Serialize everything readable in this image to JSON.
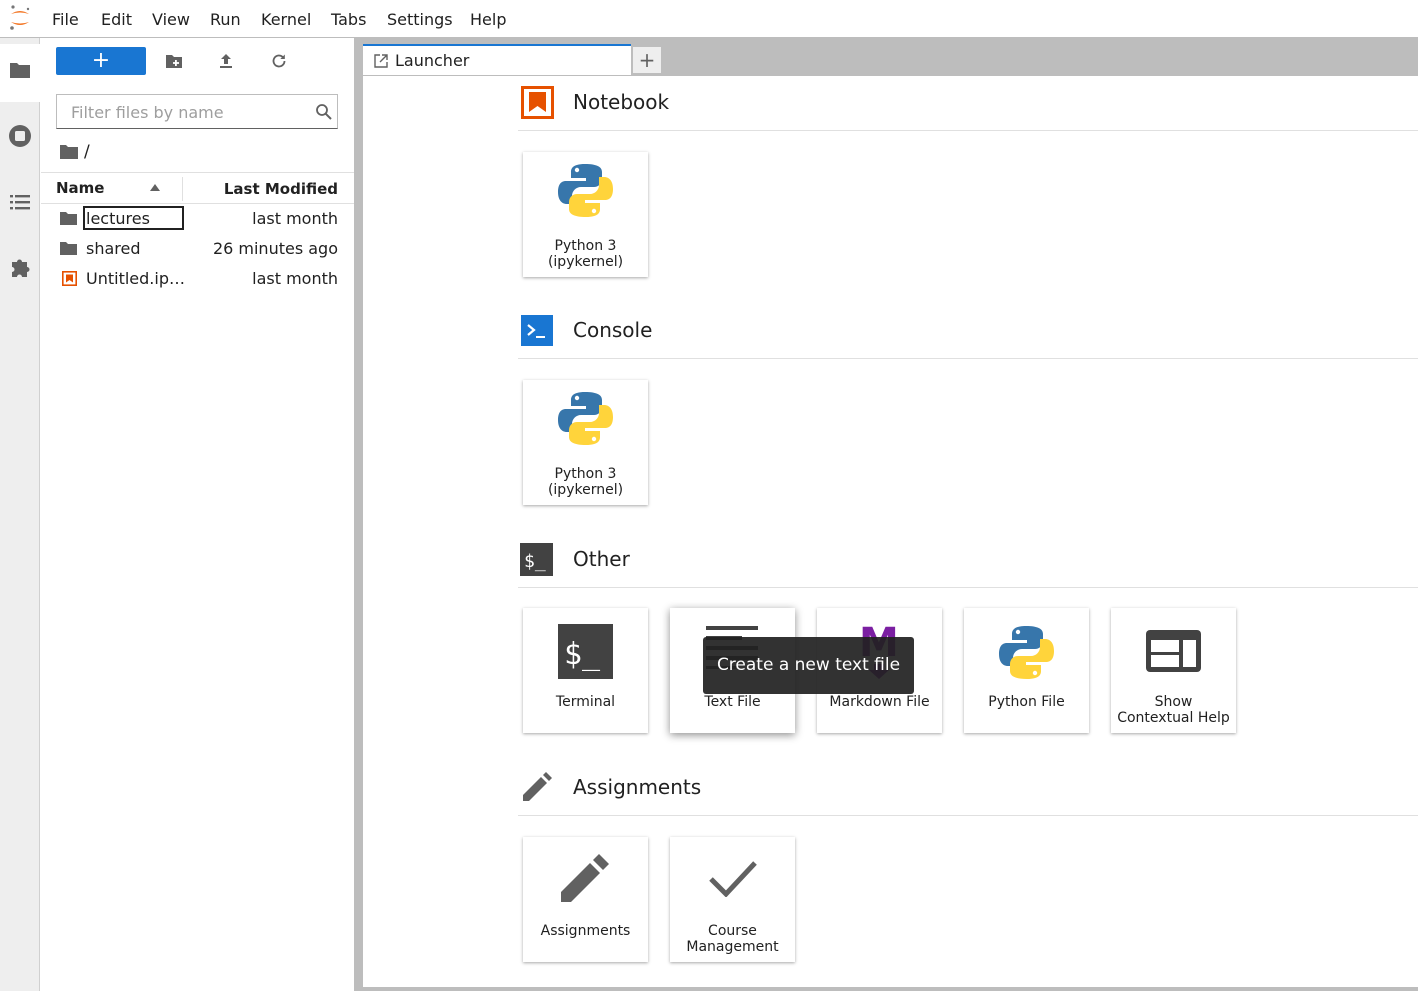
{
  "menubar": {
    "items": [
      "File",
      "Edit",
      "View",
      "Run",
      "Kernel",
      "Tabs",
      "Settings",
      "Help"
    ]
  },
  "activity_bar": {
    "icons": [
      "folder-icon",
      "running-icon",
      "toc-icon",
      "extension-icon"
    ]
  },
  "filebrowser": {
    "new_button_label": "+",
    "filter_placeholder": "Filter files by name",
    "breadcrumb": "/",
    "columns": {
      "name": "Name",
      "modified": "Last Modified"
    },
    "files": [
      {
        "name": "lectures",
        "modified": "last month",
        "type": "folder",
        "renaming": true
      },
      {
        "name": "shared",
        "modified": "26 minutes ago",
        "type": "folder",
        "renaming": false
      },
      {
        "name": "Untitled.ip…",
        "modified": "last month",
        "type": "notebook",
        "renaming": false
      }
    ]
  },
  "tabs": {
    "active": "Launcher",
    "add_label": "+"
  },
  "launcher": {
    "sections": [
      {
        "title": "Notebook",
        "cards": [
          {
            "label": "Python 3\n(ipykernel)"
          }
        ]
      },
      {
        "title": "Console",
        "cards": [
          {
            "label": "Python 3\n(ipykernel)"
          }
        ]
      },
      {
        "title": "Other",
        "cards": [
          {
            "label": "Terminal"
          },
          {
            "label": "Text File"
          },
          {
            "label": "Markdown File"
          },
          {
            "label": "Python File"
          },
          {
            "label": "Show\nContextual Help"
          }
        ]
      },
      {
        "title": "Assignments",
        "cards": [
          {
            "label": "Assignments"
          },
          {
            "label": "Course\nManagement"
          }
        ]
      }
    ]
  },
  "tooltip": "Create a new text file",
  "colors": {
    "accent": "#1976d2",
    "notebook_orange": "#e65100",
    "markdown_purple": "#7b1fa2",
    "python_blue": "#3776ab",
    "python_yellow": "#ffd43b"
  }
}
